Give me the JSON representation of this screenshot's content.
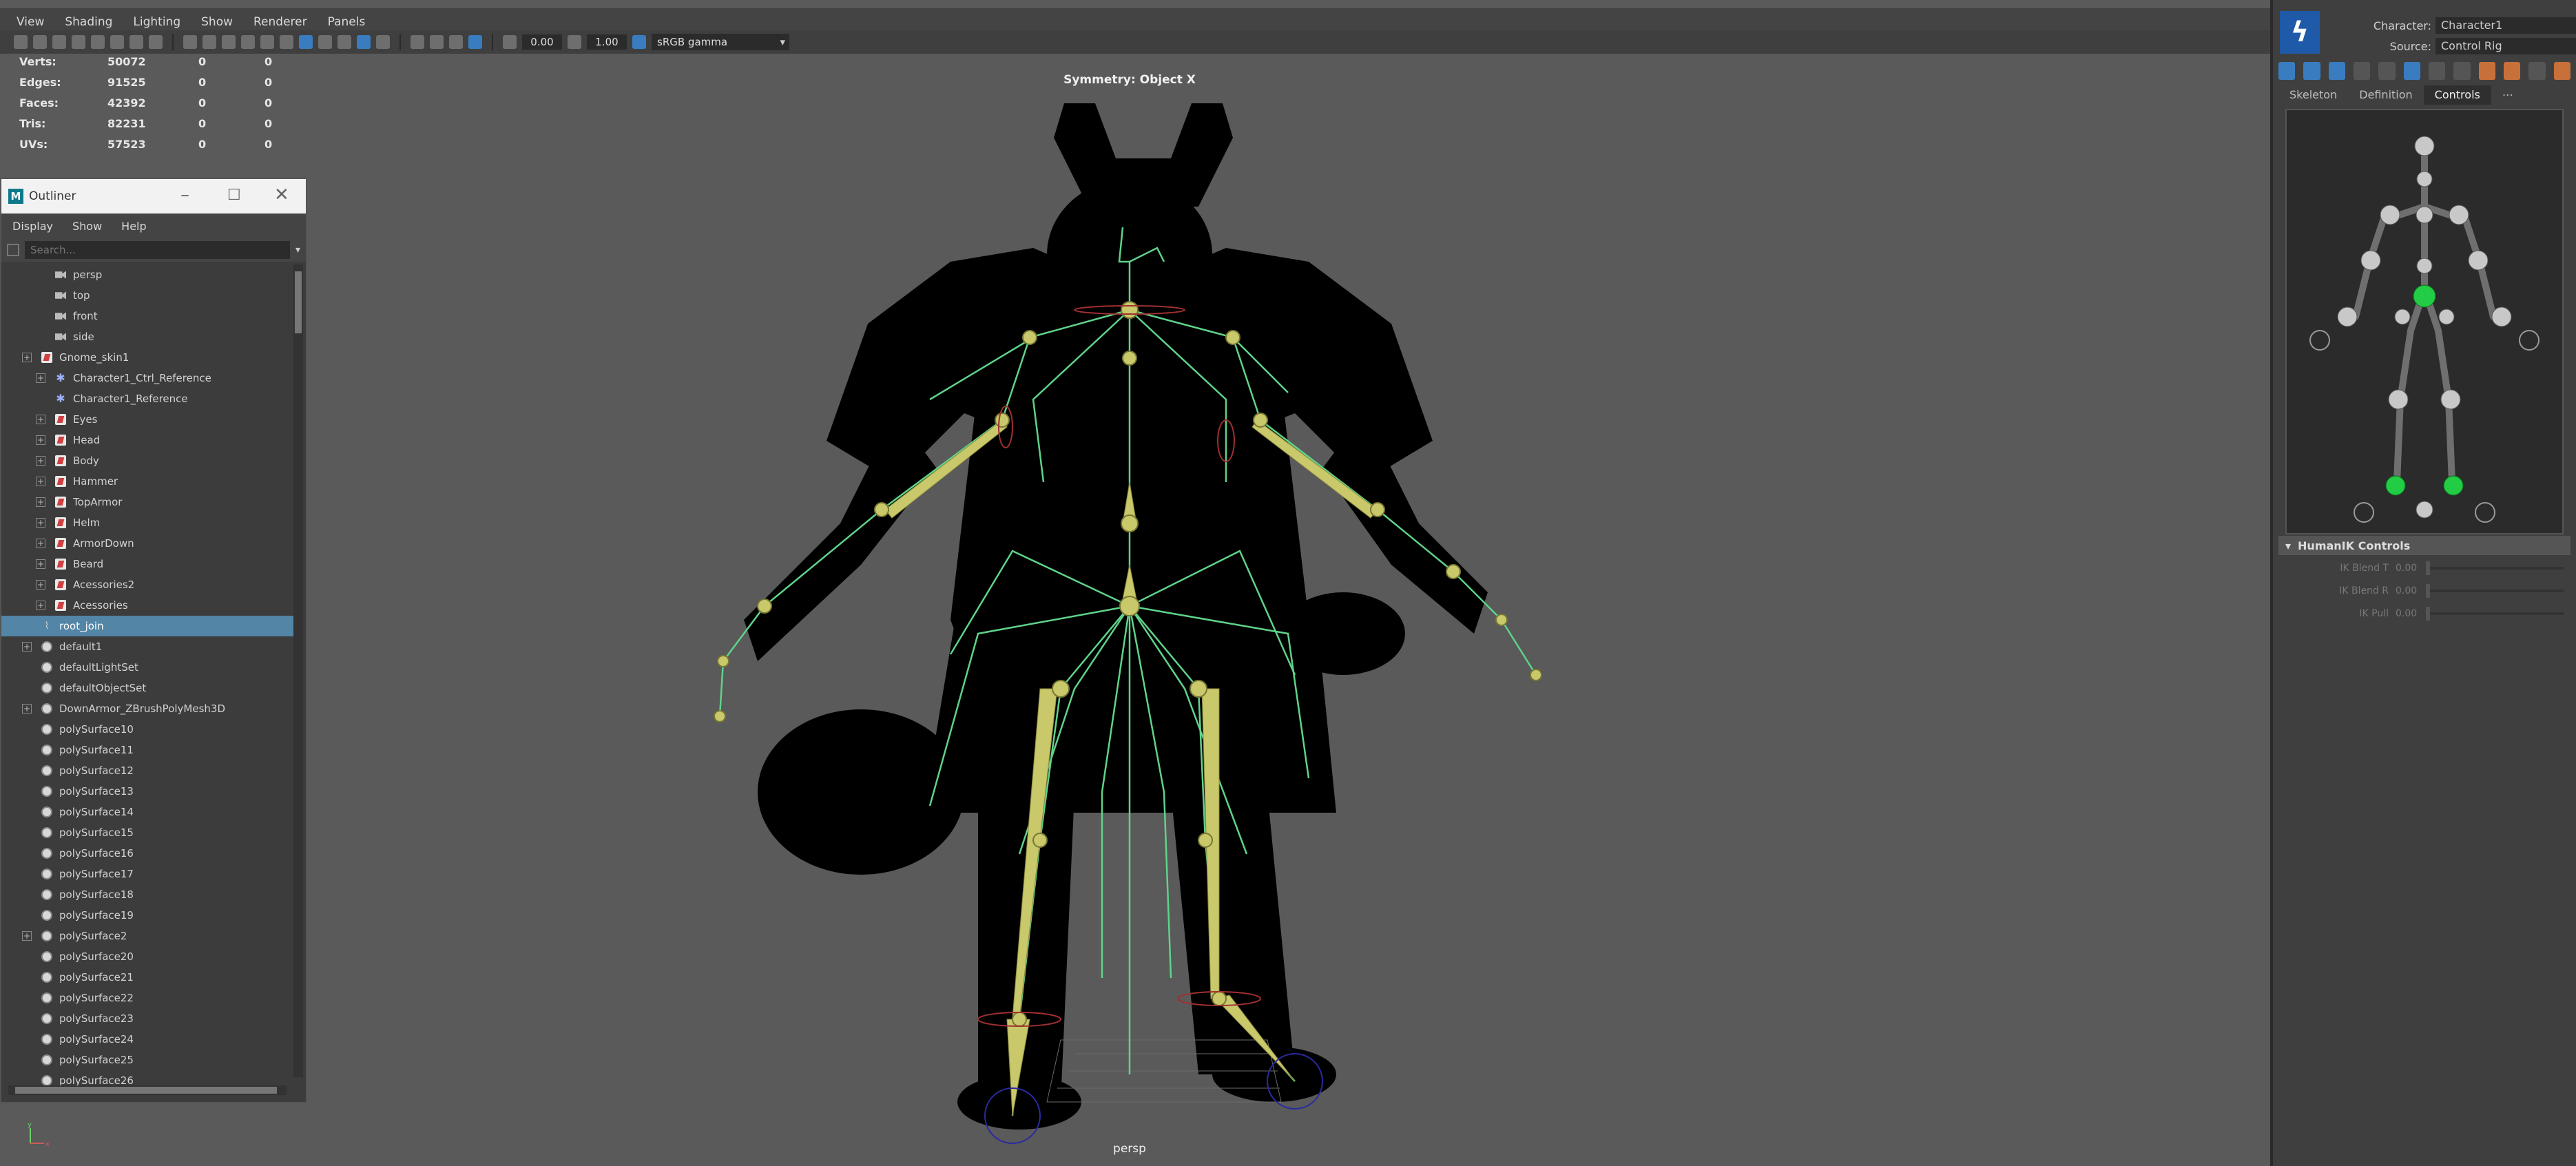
{
  "viewport": {
    "menu": [
      "View",
      "Shading",
      "Lighting",
      "Show",
      "Renderer",
      "Panels"
    ],
    "toolbar": {
      "value1": "0.00",
      "value2": "1.00",
      "colorspace": "sRGB gamma"
    },
    "hud": [
      {
        "label": "Verts:",
        "v1": "50072",
        "v2": "0",
        "v3": "0"
      },
      {
        "label": "Edges:",
        "v1": "91525",
        "v2": "0",
        "v3": "0"
      },
      {
        "label": "Faces:",
        "v1": "42392",
        "v2": "0",
        "v3": "0"
      },
      {
        "label": "Tris:",
        "v1": "82231",
        "v2": "0",
        "v3": "0"
      },
      {
        "label": "UVs:",
        "v1": "57523",
        "v2": "0",
        "v3": "0"
      }
    ],
    "symmetry": "Symmetry: Object X",
    "camera_label": "persp"
  },
  "outliner": {
    "title": "Outliner",
    "menu": [
      "Display",
      "Show",
      "Help"
    ],
    "search_placeholder": "Search...",
    "items": [
      {
        "label": "persp",
        "icon": "camera-icon",
        "indent": 1,
        "expand": false
      },
      {
        "label": "top",
        "icon": "camera-icon",
        "indent": 1,
        "expand": false
      },
      {
        "label": "front",
        "icon": "camera-icon",
        "indent": 1,
        "expand": false
      },
      {
        "label": "side",
        "icon": "camera-icon",
        "indent": 1,
        "expand": false
      },
      {
        "label": "Gnome_skin1",
        "icon": "group-icon",
        "indent": 0,
        "expand": true
      },
      {
        "label": "Character1_Ctrl_Reference",
        "icon": "reference-icon",
        "indent": 1,
        "expand": true
      },
      {
        "label": "Character1_Reference",
        "icon": "reference-icon",
        "indent": 1,
        "expand": false
      },
      {
        "label": "Eyes",
        "icon": "group-icon",
        "indent": 1,
        "expand": true
      },
      {
        "label": "Head",
        "icon": "group-icon",
        "indent": 1,
        "expand": true
      },
      {
        "label": "Body",
        "icon": "group-icon",
        "indent": 1,
        "expand": true
      },
      {
        "label": "Hammer",
        "icon": "group-icon",
        "indent": 1,
        "expand": true
      },
      {
        "label": "TopArmor",
        "icon": "group-icon",
        "indent": 1,
        "expand": true
      },
      {
        "label": "Helm",
        "icon": "group-icon",
        "indent": 1,
        "expand": true
      },
      {
        "label": "ArmorDown",
        "icon": "group-icon",
        "indent": 1,
        "expand": true
      },
      {
        "label": "Beard",
        "icon": "group-icon",
        "indent": 1,
        "expand": true
      },
      {
        "label": "Acessories2",
        "icon": "group-icon",
        "indent": 1,
        "expand": true
      },
      {
        "label": "Acessories",
        "icon": "group-icon",
        "indent": 1,
        "expand": true
      },
      {
        "label": "root_join",
        "icon": "joint-icon",
        "indent": 0,
        "expand": false,
        "selected": true
      },
      {
        "label": "default1",
        "icon": "set-icon",
        "indent": 0,
        "expand": true
      },
      {
        "label": "defaultLightSet",
        "icon": "set-icon",
        "indent": 0,
        "expand": false
      },
      {
        "label": "defaultObjectSet",
        "icon": "set-icon",
        "indent": 0,
        "expand": false
      },
      {
        "label": "DownArmor_ZBrushPolyMesh3D",
        "icon": "set-icon",
        "indent": 0,
        "expand": true
      },
      {
        "label": "polySurface10",
        "icon": "set-icon",
        "indent": 0,
        "expand": false
      },
      {
        "label": "polySurface11",
        "icon": "set-icon",
        "indent": 0,
        "expand": false
      },
      {
        "label": "polySurface12",
        "icon": "set-icon",
        "indent": 0,
        "expand": false
      },
      {
        "label": "polySurface13",
        "icon": "set-icon",
        "indent": 0,
        "expand": false
      },
      {
        "label": "polySurface14",
        "icon": "set-icon",
        "indent": 0,
        "expand": false
      },
      {
        "label": "polySurface15",
        "icon": "set-icon",
        "indent": 0,
        "expand": false
      },
      {
        "label": "polySurface16",
        "icon": "set-icon",
        "indent": 0,
        "expand": false
      },
      {
        "label": "polySurface17",
        "icon": "set-icon",
        "indent": 0,
        "expand": false
      },
      {
        "label": "polySurface18",
        "icon": "set-icon",
        "indent": 0,
        "expand": false
      },
      {
        "label": "polySurface19",
        "icon": "set-icon",
        "indent": 0,
        "expand": false
      },
      {
        "label": "polySurface2",
        "icon": "set-icon",
        "indent": 0,
        "expand": true
      },
      {
        "label": "polySurface20",
        "icon": "set-icon",
        "indent": 0,
        "expand": false
      },
      {
        "label": "polySurface21",
        "icon": "set-icon",
        "indent": 0,
        "expand": false
      },
      {
        "label": "polySurface22",
        "icon": "set-icon",
        "indent": 0,
        "expand": false
      },
      {
        "label": "polySurface23",
        "icon": "set-icon",
        "indent": 0,
        "expand": false
      },
      {
        "label": "polySurface24",
        "icon": "set-icon",
        "indent": 0,
        "expand": false
      },
      {
        "label": "polySurface25",
        "icon": "set-icon",
        "indent": 0,
        "expand": false
      },
      {
        "label": "polySurface26",
        "icon": "set-icon",
        "indent": 0,
        "expand": false
      }
    ]
  },
  "humanik": {
    "character_label": "Character:",
    "character_value": "Character1",
    "source_label": "Source:",
    "source_value": "Control Rig",
    "tabs": [
      "Skeleton",
      "Definition",
      "Controls"
    ],
    "active_tab": "Controls",
    "section_title": "HumanIK Controls",
    "sliders": [
      {
        "label": "IK Blend T",
        "value": "0.00"
      },
      {
        "label": "IK Blend R",
        "value": "0.00"
      },
      {
        "label": "IK Pull",
        "value": "0.00"
      }
    ]
  },
  "colors": {
    "viewport_bg": "#5a5a5a",
    "skeleton_green": "#5fd38a",
    "joint_yellow": "#c9c86a",
    "selection_blue": "#5285a6",
    "hik_active": "#22cc44"
  }
}
